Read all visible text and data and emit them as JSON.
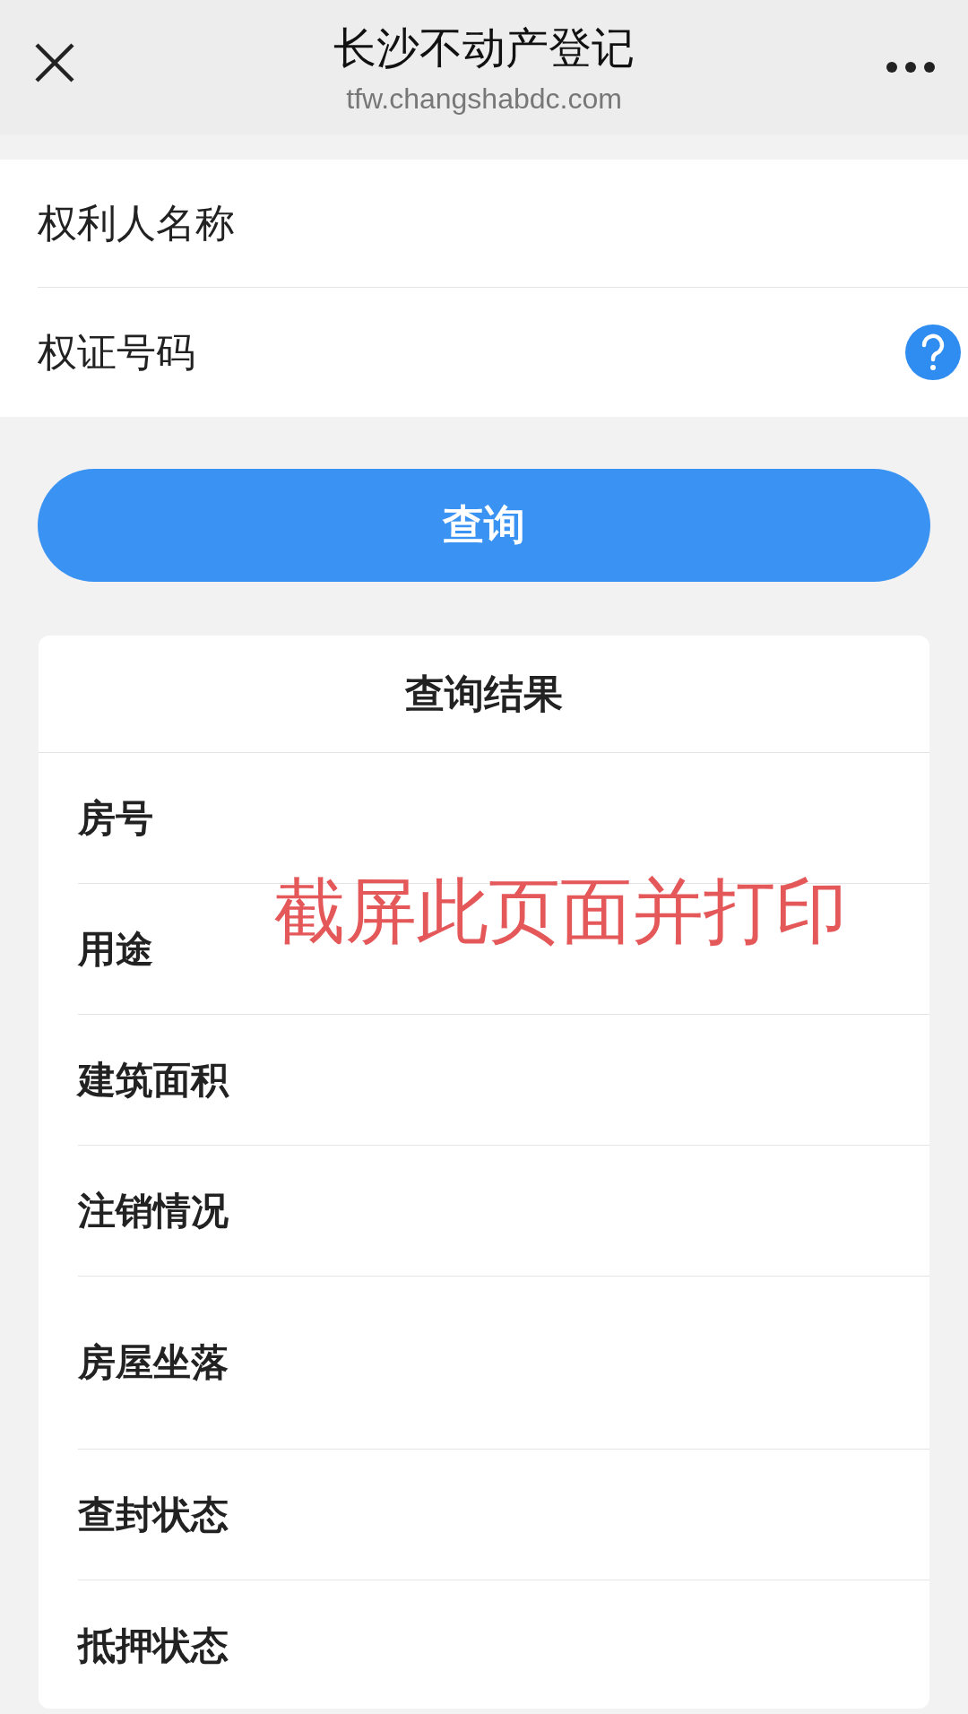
{
  "header": {
    "title": "长沙不动产登记",
    "url": "tfw.changshabdc.com"
  },
  "form": {
    "fields": [
      {
        "label": "权利人名称",
        "help": false
      },
      {
        "label": "权证号码",
        "help": true
      }
    ]
  },
  "query_button": "查询",
  "results": {
    "title": "查询结果",
    "rows": [
      {
        "label": "房号",
        "tall": false
      },
      {
        "label": "用途",
        "tall": false
      },
      {
        "label": "建筑面积",
        "tall": false
      },
      {
        "label": "注销情况",
        "tall": false
      },
      {
        "label": "房屋坐落",
        "tall": true
      },
      {
        "label": "查封状态",
        "tall": false
      },
      {
        "label": "抵押状态",
        "tall": false
      }
    ]
  },
  "annotation": "截屏此页面并打印"
}
